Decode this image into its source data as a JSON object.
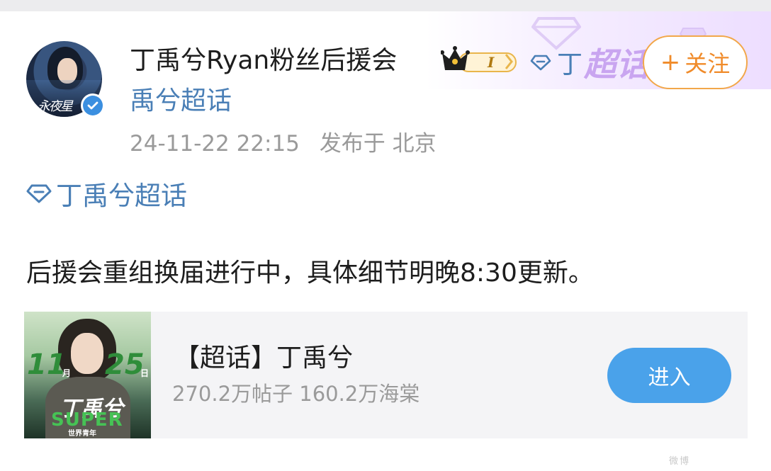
{
  "user": {
    "name": "丁禹兮Ryan粉丝后援会",
    "badge_level": "I",
    "avatar_text": "永夜星"
  },
  "topic_inline": {
    "part1": "丁",
    "part2": "超话",
    "continuation": "禹兮超话"
  },
  "follow": {
    "plus": "+",
    "label": "关注"
  },
  "meta": {
    "timestamp": "24-11-22 22:15",
    "location": "发布于 北京"
  },
  "topic_tag": {
    "label": "丁禹兮超话"
  },
  "post": {
    "text": "后援会重组换届进行中，具体细节明晚8:30更新。"
  },
  "card": {
    "title": "【超话】丁禹兮",
    "stats": "270.2万帖子 160.2万海棠",
    "button_label": "进入",
    "cover": {
      "month": "11",
      "month_unit": "月",
      "day": "25",
      "day_unit": "日",
      "name": "丁禹兮",
      "super": "SUPER",
      "sub": "世界青年"
    }
  },
  "watermark": "微博",
  "colors": {
    "link": "#4a7fb6",
    "follow": "#f08b2a",
    "enter_button": "#4aa2ea",
    "muted": "#9a9a9a"
  }
}
